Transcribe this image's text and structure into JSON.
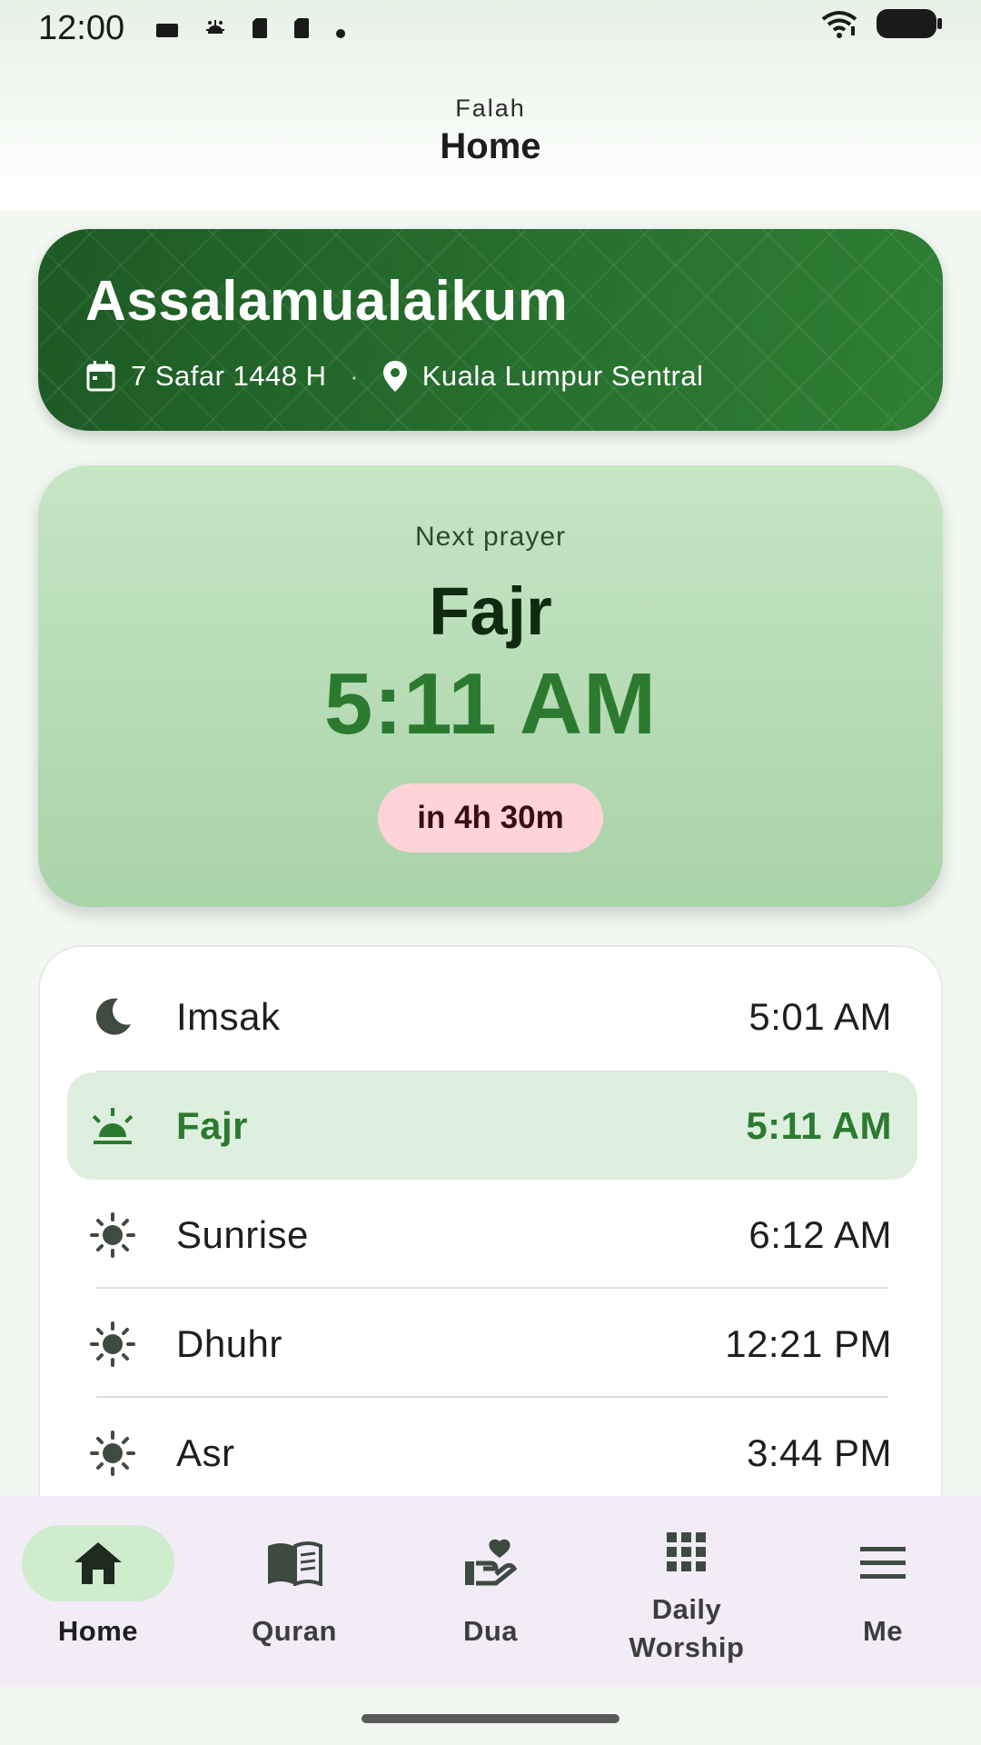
{
  "status_bar": {
    "time": "12:00",
    "left_icons": [
      "notification-icon",
      "android-icon",
      "sd-card-icon",
      "sd-card-icon",
      "dot-icon"
    ],
    "right_icons": [
      "wifi-icon",
      "battery-icon"
    ]
  },
  "header": {
    "app_name": "Falah",
    "title": "Home"
  },
  "greeting": {
    "text": "Assalamualaikum",
    "hijri_date": "7 Safar 1448 H",
    "separator": "·",
    "location": "Kuala Lumpur Sentral",
    "colors": {
      "card_dark": "#1d5a24",
      "card_light": "#2f7f35"
    }
  },
  "next_prayer": {
    "label": "Next prayer",
    "name": "Fajr",
    "time": "5:11 AM",
    "countdown": "in 4h 30m",
    "colors": {
      "time": "#2b7a30",
      "countdown_bg": "#ffd3d7"
    }
  },
  "prayers": [
    {
      "name": "Imsak",
      "time": "5:01 AM",
      "icon": "moon-icon",
      "active": false
    },
    {
      "name": "Fajr",
      "time": "5:11 AM",
      "icon": "sunrise-horizon-icon",
      "active": true
    },
    {
      "name": "Sunrise",
      "time": "6:12 AM",
      "icon": "sun-icon",
      "active": false
    },
    {
      "name": "Dhuhr",
      "time": "12:21 PM",
      "icon": "sun-icon",
      "active": false
    },
    {
      "name": "Asr",
      "time": "3:44 PM",
      "icon": "sun-icon",
      "active": false
    }
  ],
  "bottom_nav": [
    {
      "label": "Home",
      "icon": "home-icon",
      "active": true
    },
    {
      "label": "Quran",
      "icon": "book-icon",
      "active": false
    },
    {
      "label": "Dua",
      "icon": "hand-heart-icon",
      "active": false
    },
    {
      "label": "Daily\nWorship",
      "icon": "grid-icon",
      "active": false
    },
    {
      "label": "Me",
      "icon": "menu-icon",
      "active": false
    }
  ]
}
